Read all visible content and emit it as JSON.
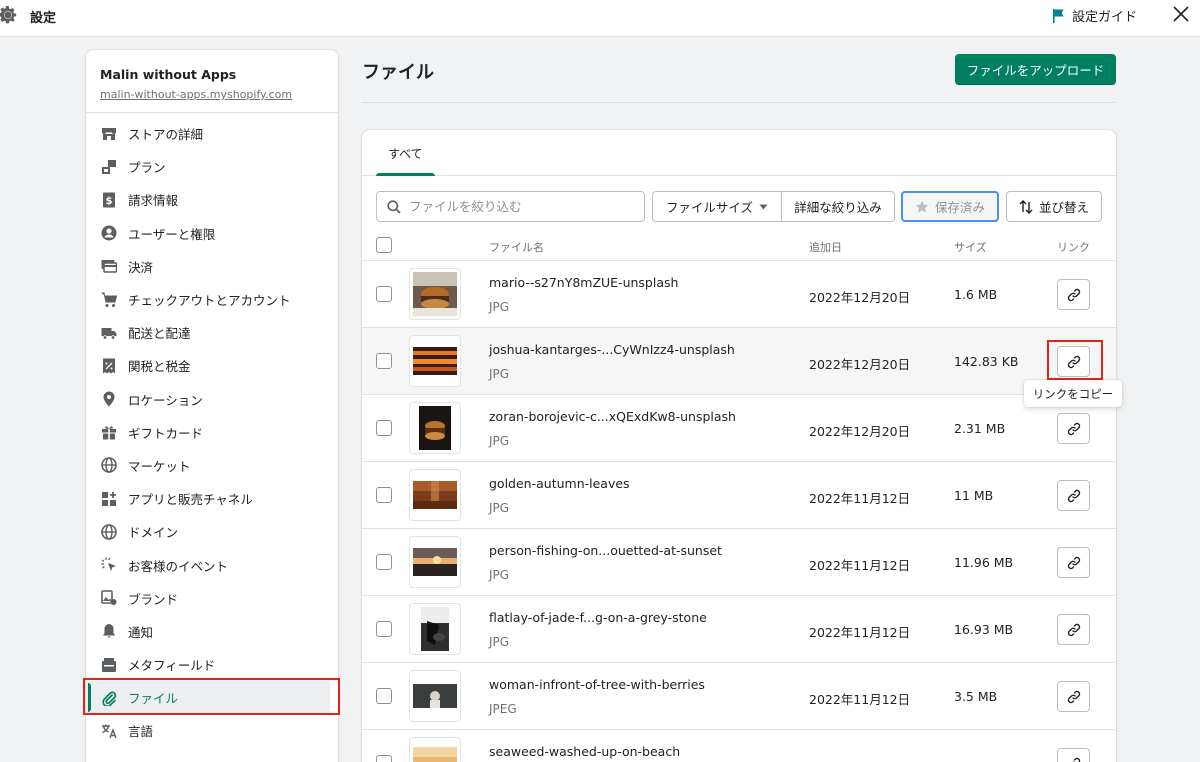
{
  "topbar": {
    "title": "設定",
    "guide_label": "設定ガイド"
  },
  "store": {
    "name": "Malin without Apps",
    "url": "malin-without-apps.myshopify.com"
  },
  "sidebar": {
    "items": [
      {
        "label": "ストアの詳細",
        "icon": "store-icon"
      },
      {
        "label": "プラン",
        "icon": "plan-icon"
      },
      {
        "label": "請求情報",
        "icon": "billing-icon"
      },
      {
        "label": "ユーザーと権限",
        "icon": "user-icon"
      },
      {
        "label": "決済",
        "icon": "payment-icon"
      },
      {
        "label": "チェックアウトとアカウント",
        "icon": "cart-icon"
      },
      {
        "label": "配送と配達",
        "icon": "truck-icon"
      },
      {
        "label": "関税と税金",
        "icon": "tax-icon"
      },
      {
        "label": "ロケーション",
        "icon": "location-icon"
      },
      {
        "label": "ギフトカード",
        "icon": "gift-icon"
      },
      {
        "label": "マーケット",
        "icon": "globe-icon"
      },
      {
        "label": "アプリと販売チャネル",
        "icon": "apps-icon"
      },
      {
        "label": "ドメイン",
        "icon": "globe-icon"
      },
      {
        "label": "お客様のイベント",
        "icon": "cursor-icon"
      },
      {
        "label": "ブランド",
        "icon": "brand-icon"
      },
      {
        "label": "通知",
        "icon": "bell-icon"
      },
      {
        "label": "メタフィールド",
        "icon": "metafield-icon"
      },
      {
        "label": "ファイル",
        "icon": "link-icon",
        "active": true
      },
      {
        "label": "言語",
        "icon": "language-icon"
      }
    ]
  },
  "main": {
    "title": "ファイル",
    "upload_label": "ファイルをアップロード",
    "tab_all": "すべて",
    "search_placeholder": "ファイルを絞り込む",
    "filter_size": "ファイルサイズ",
    "filter_detail": "詳細な絞り込み",
    "filter_saved": "保存済み",
    "sort_label": "並び替え",
    "columns": {
      "name": "ファイル名",
      "date": "追加日",
      "size": "サイズ",
      "link": "リンク"
    },
    "files": [
      {
        "name": "mario--s27nY8mZUE-unsplash",
        "type": "JPG",
        "date": "2022年12月20日",
        "size": "1.6 MB"
      },
      {
        "name": "joshua-kantarges-...CyWnIzz4-unsplash",
        "type": "JPG",
        "date": "2022年12月20日",
        "size": "142.83 KB"
      },
      {
        "name": "zoran-borojevic-c...xQExdKw8-unsplash",
        "type": "JPG",
        "date": "2022年12月20日",
        "size": "2.31 MB"
      },
      {
        "name": "golden-autumn-leaves",
        "type": "JPG",
        "date": "2022年11月12日",
        "size": "11 MB"
      },
      {
        "name": "person-fishing-on...ouetted-at-sunset",
        "type": "JPG",
        "date": "2022年11月12日",
        "size": "11.96 MB"
      },
      {
        "name": "flatlay-of-jade-f...g-on-a-grey-stone",
        "type": "JPG",
        "date": "2022年11月12日",
        "size": "16.93 MB"
      },
      {
        "name": "woman-infront-of-tree-with-berries",
        "type": "JPEG",
        "date": "2022年11月12日",
        "size": "3.5 MB"
      },
      {
        "name": "seaweed-washed-up-on-beach",
        "type": "",
        "date": "",
        "size": ""
      }
    ],
    "tooltip": "リンクをコピー"
  },
  "colors": {
    "accent": "#008060",
    "highlight": "#e0241a",
    "focus": "#458fff"
  }
}
